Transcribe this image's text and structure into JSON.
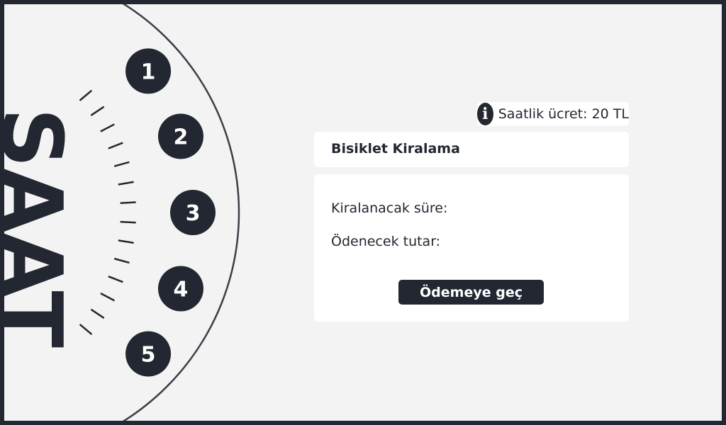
{
  "dial": {
    "title": "SAAT",
    "hours": [
      "1",
      "2",
      "3",
      "4",
      "5"
    ]
  },
  "rate": {
    "icon": "info-icon",
    "text": "Saatlik ücret: 20 TL"
  },
  "rental": {
    "title": "Bisiklet Kiralama",
    "duration_label": "Kiralanacak süre:",
    "amount_label": "Ödenecek tutar:",
    "pay_button": "Ödemeye geç"
  },
  "colors": {
    "dark": "#222731",
    "background": "#f3f3f3",
    "card": "#ffffff"
  }
}
